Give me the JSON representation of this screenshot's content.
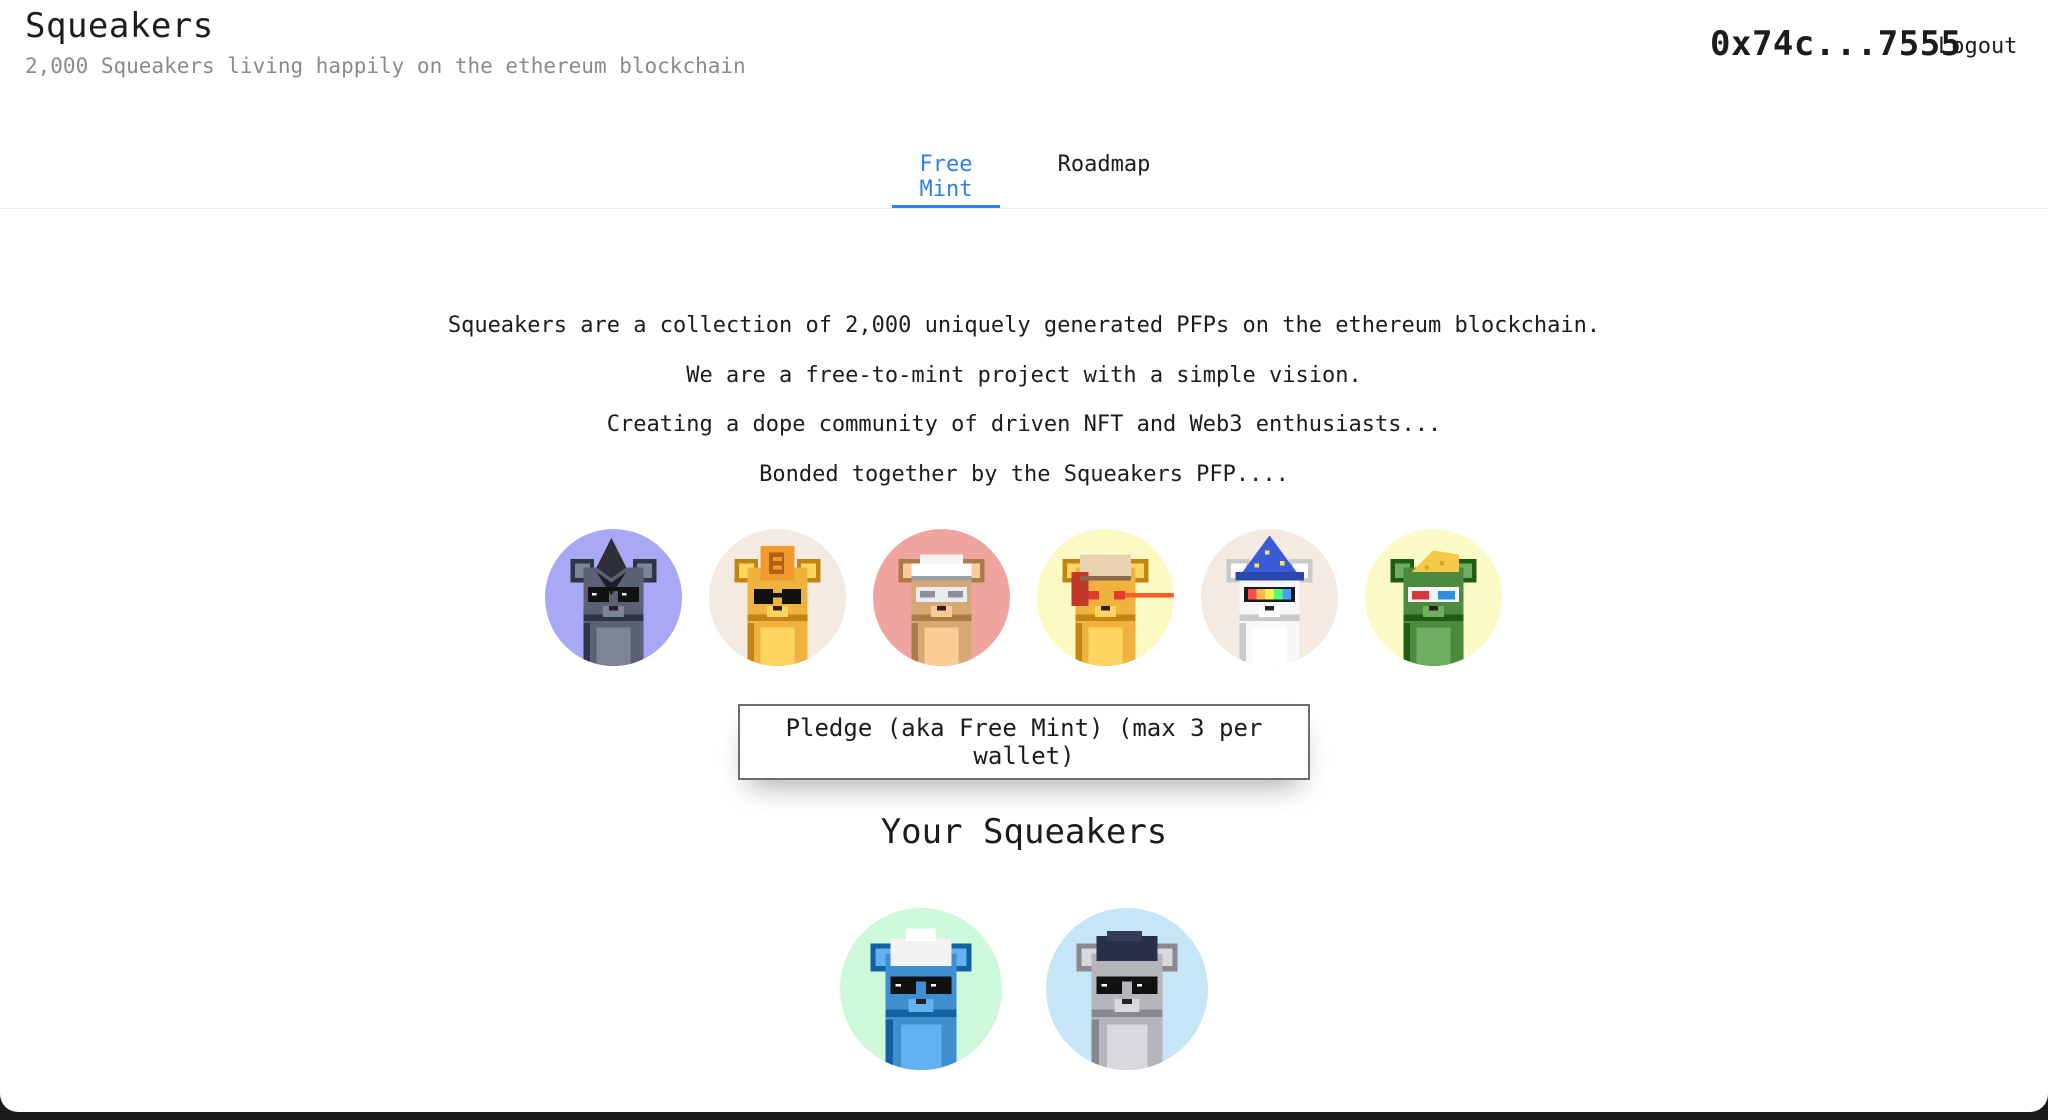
{
  "header": {
    "title": "Squeakers",
    "subtitle": "2,000 Squeakers living happily on the ethereum blockchain",
    "wallet_address": "0x74c...7555",
    "logout_label": "Logout"
  },
  "tabs": [
    {
      "label": "Free Mint",
      "active": true
    },
    {
      "label": "Roadmap",
      "active": false
    }
  ],
  "intro": {
    "lines": [
      "Squeakers are a collection of 2,000 uniquely generated PFPs on the ethereum blockchain.",
      "We are a free-to-mint project with a simple vision.",
      "Creating a dope community of driven NFT and Web3 enthusiasts...",
      "Bonded together by the Squeakers PFP...."
    ]
  },
  "showcase": [
    {
      "bg": "#a8a8f5",
      "fur": "#5c6074",
      "hat": "ethereum-diamond",
      "eyes": "black-sunglasses"
    },
    {
      "bg": "#f3ebe1",
      "fur": "#f0b23f",
      "hat": "bitcoin-coin",
      "eyes": "round-black-glasses"
    },
    {
      "bg": "#f0a49f",
      "fur": "#d8a874",
      "hat": "sailor-cap",
      "eyes": "grey-visor"
    },
    {
      "bg": "#fdf9c2",
      "fur": "#f0b23f",
      "hat": "aviator-cap",
      "eyes": "laser-eyes"
    },
    {
      "bg": "#f3ebe1",
      "fur": "#f7f7f7",
      "hat": "wizard-hat",
      "eyes": "rainbow-visor"
    },
    {
      "bg": "#fcfac6",
      "fur": "#4e8a3e",
      "hat": "cheese-wedge",
      "eyes": "3d-glasses"
    }
  ],
  "mint": {
    "button_label": "Pledge (aka Free Mint) (max 3 per wallet)"
  },
  "your_squeakers": {
    "title": "Your Squeakers",
    "items": [
      {
        "bg": "#cdf8d9",
        "fur": "#3e8ed0",
        "hat": "white-beanie",
        "eyes": "black-sunglasses"
      },
      {
        "bg": "#c6e5f7",
        "fur": "#b4b6bc",
        "hat": "dark-hair",
        "eyes": "black-sunglasses"
      }
    ]
  },
  "colors": {
    "accent": "#2f80ed",
    "text": "#1c1c1c",
    "muted": "#8a8a8a"
  }
}
